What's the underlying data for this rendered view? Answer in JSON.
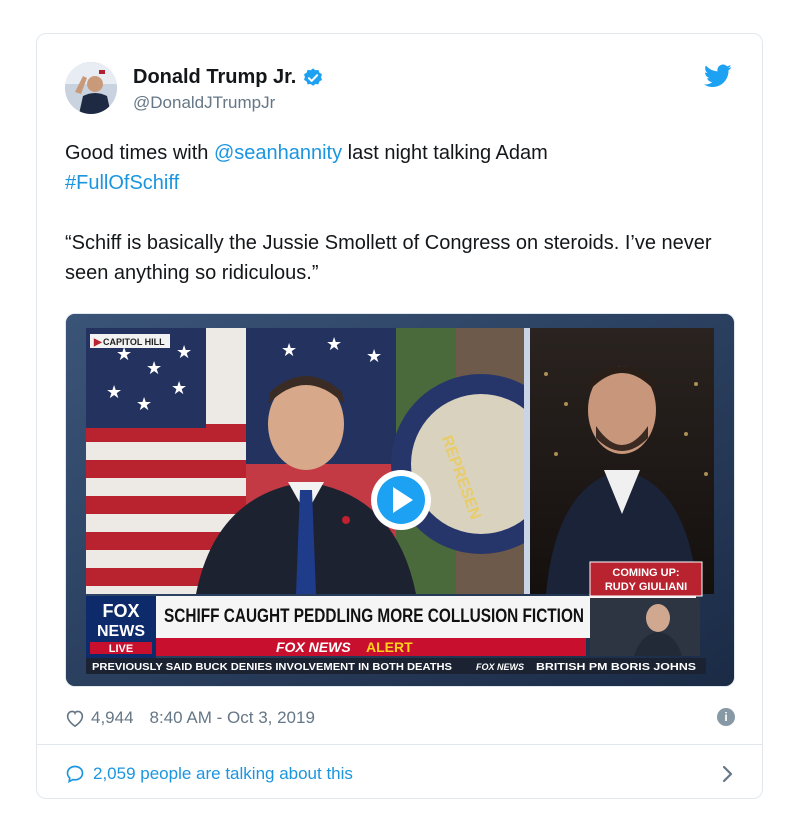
{
  "tweet": {
    "author_name": "Donald Trump Jr.",
    "author_handle": "@DonaldJTrumpJr",
    "text_before_mention": "Good times with ",
    "mention": "@seanhannity",
    "text_after_mention": " last night talking Adam",
    "hashtag": "#FullOfSchiff",
    "quote": "“Schiff is basically the Jussie Smollett of Congress on steroids. I’ve never seen anything so ridiculous.”",
    "likes": "4,944",
    "timestamp": "8:40 AM - Oct 3, 2019",
    "talking": "2,059 people are talking about this"
  },
  "video": {
    "location_tag": "CAPITOL HILL",
    "seal_text": "REPRESEN",
    "coming_up_line1": "COMING UP:",
    "coming_up_line2": "RUDY GIULIANI",
    "logo_fox": "FOX",
    "logo_news": "NEWS",
    "logo_live": "LIVE",
    "headline": "SCHIFF CAUGHT PEDDLING MORE COLLUSION FICTION",
    "alert_prefix": "FOX NEWS",
    "alert_word": "ALERT",
    "ticker_left": "PREVIOUSLY SAID BUCK DENIES INVOLVEMENT IN BOTH DEATHS",
    "ticker_logo": "FOX NEWS",
    "ticker_right": "BRITISH PM BORIS JOHNS"
  },
  "colors": {
    "link": "#1b95e0",
    "twitter_blue": "#1da1f2",
    "verified": "#1da1f2",
    "fox_red": "#c8102e",
    "alert_yellow": "#ffd21a"
  },
  "icons": [
    "twitter-bird-icon",
    "verified-badge-icon",
    "play-icon",
    "heart-icon",
    "info-icon",
    "speech-bubble-icon",
    "chevron-right-icon"
  ]
}
